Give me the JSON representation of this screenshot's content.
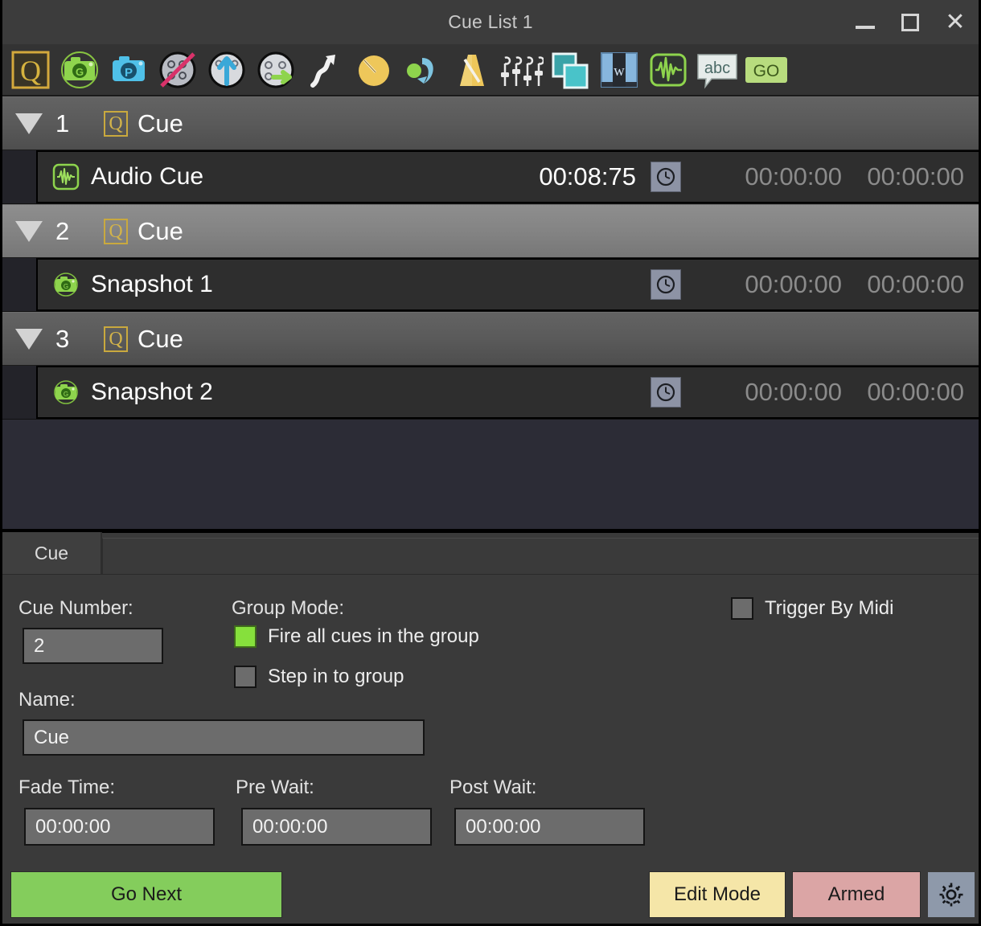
{
  "window": {
    "title": "Cue List 1",
    "controls": [
      {
        "name": "minimize",
        "glyph": "—"
      },
      {
        "name": "maximize",
        "glyph": "□"
      },
      {
        "name": "close",
        "glyph": "✕"
      }
    ]
  },
  "toolbar": {
    "items": [
      {
        "name": "cue-icon",
        "label": "Cue"
      },
      {
        "name": "snapshot-go-icon",
        "label": "Snapshot Go"
      },
      {
        "name": "snapshot-preset-icon",
        "label": "Snapshot Preset"
      },
      {
        "name": "disable-fader-icon",
        "label": "Disable Fader"
      },
      {
        "name": "fader-up-icon",
        "label": "Fader Up"
      },
      {
        "name": "fader-go-icon",
        "label": "Fader Go"
      },
      {
        "name": "path-arrow-icon",
        "label": "Path"
      },
      {
        "name": "fade-knob-icon",
        "label": "Fade"
      },
      {
        "name": "recall-icon",
        "label": "Recall"
      },
      {
        "name": "metronome-icon",
        "label": "Metronome"
      },
      {
        "name": "faders-icon",
        "label": "Faders"
      },
      {
        "name": "layers-icon",
        "label": "Layers"
      },
      {
        "name": "window-icon",
        "label": "Window"
      },
      {
        "name": "audio-wave-icon",
        "label": "Audio Cue"
      },
      {
        "name": "text-bubble-icon",
        "label": "Text"
      },
      {
        "name": "go-icon",
        "label": "GO"
      }
    ]
  },
  "cue_list": {
    "rows": [
      {
        "kind": "group",
        "selected": false,
        "number": "1",
        "icon": "cue-q-icon",
        "name": "Cue",
        "children": [
          {
            "kind": "child",
            "icon": "audio-wave-icon",
            "name": "Audio Cue",
            "elapsed": "00:08:75",
            "clock": "clock-icon",
            "pre_wait": "00:00:00",
            "post_wait": "00:00:00"
          }
        ]
      },
      {
        "kind": "group",
        "selected": true,
        "number": "2",
        "icon": "cue-q-icon",
        "name": "Cue",
        "children": [
          {
            "kind": "child",
            "icon": "snapshot-icon",
            "name": "Snapshot 1",
            "elapsed": "",
            "clock": "clock-icon",
            "pre_wait": "00:00:00",
            "post_wait": "00:00:00"
          }
        ]
      },
      {
        "kind": "group",
        "selected": false,
        "number": "3",
        "icon": "cue-q-icon",
        "name": "Cue",
        "children": [
          {
            "kind": "child",
            "icon": "snapshot-icon",
            "name": "Snapshot 2",
            "elapsed": "",
            "clock": "clock-icon",
            "pre_wait": "00:00:00",
            "post_wait": "00:00:00"
          }
        ]
      }
    ]
  },
  "inspector": {
    "tabs": [
      {
        "label": "Cue",
        "active": true
      }
    ],
    "cue_number_label": "Cue Number:",
    "cue_number_value": "2",
    "name_label": "Name:",
    "name_value": "Cue",
    "group_mode_label": "Group Mode:",
    "fire_all_label": "Fire all cues in the group",
    "fire_all_checked": true,
    "step_in_label": "Step in to group",
    "step_in_checked": false,
    "trigger_midi_label": "Trigger By Midi",
    "trigger_midi_checked": false,
    "fade_time_label": "Fade Time:",
    "fade_time_value": "00:00:00",
    "pre_wait_label": "Pre Wait:",
    "pre_wait_value": "00:00:00",
    "post_wait_label": "Post Wait:",
    "post_wait_value": "00:00:00"
  },
  "buttons": {
    "go_next": "Go Next",
    "edit_mode": "Edit Mode",
    "armed": "Armed",
    "settings": "gear-icon"
  },
  "colors": {
    "go_next": "#84cd5c",
    "edit_mode": "#f5e6a8",
    "armed": "#dba5a5",
    "settings": "#8e99aa",
    "checkbox_on": "#86e03c",
    "cue_q_accent": "#d2b34a",
    "list_background": "#2c2c36",
    "window_background": "#3a3a3a"
  }
}
